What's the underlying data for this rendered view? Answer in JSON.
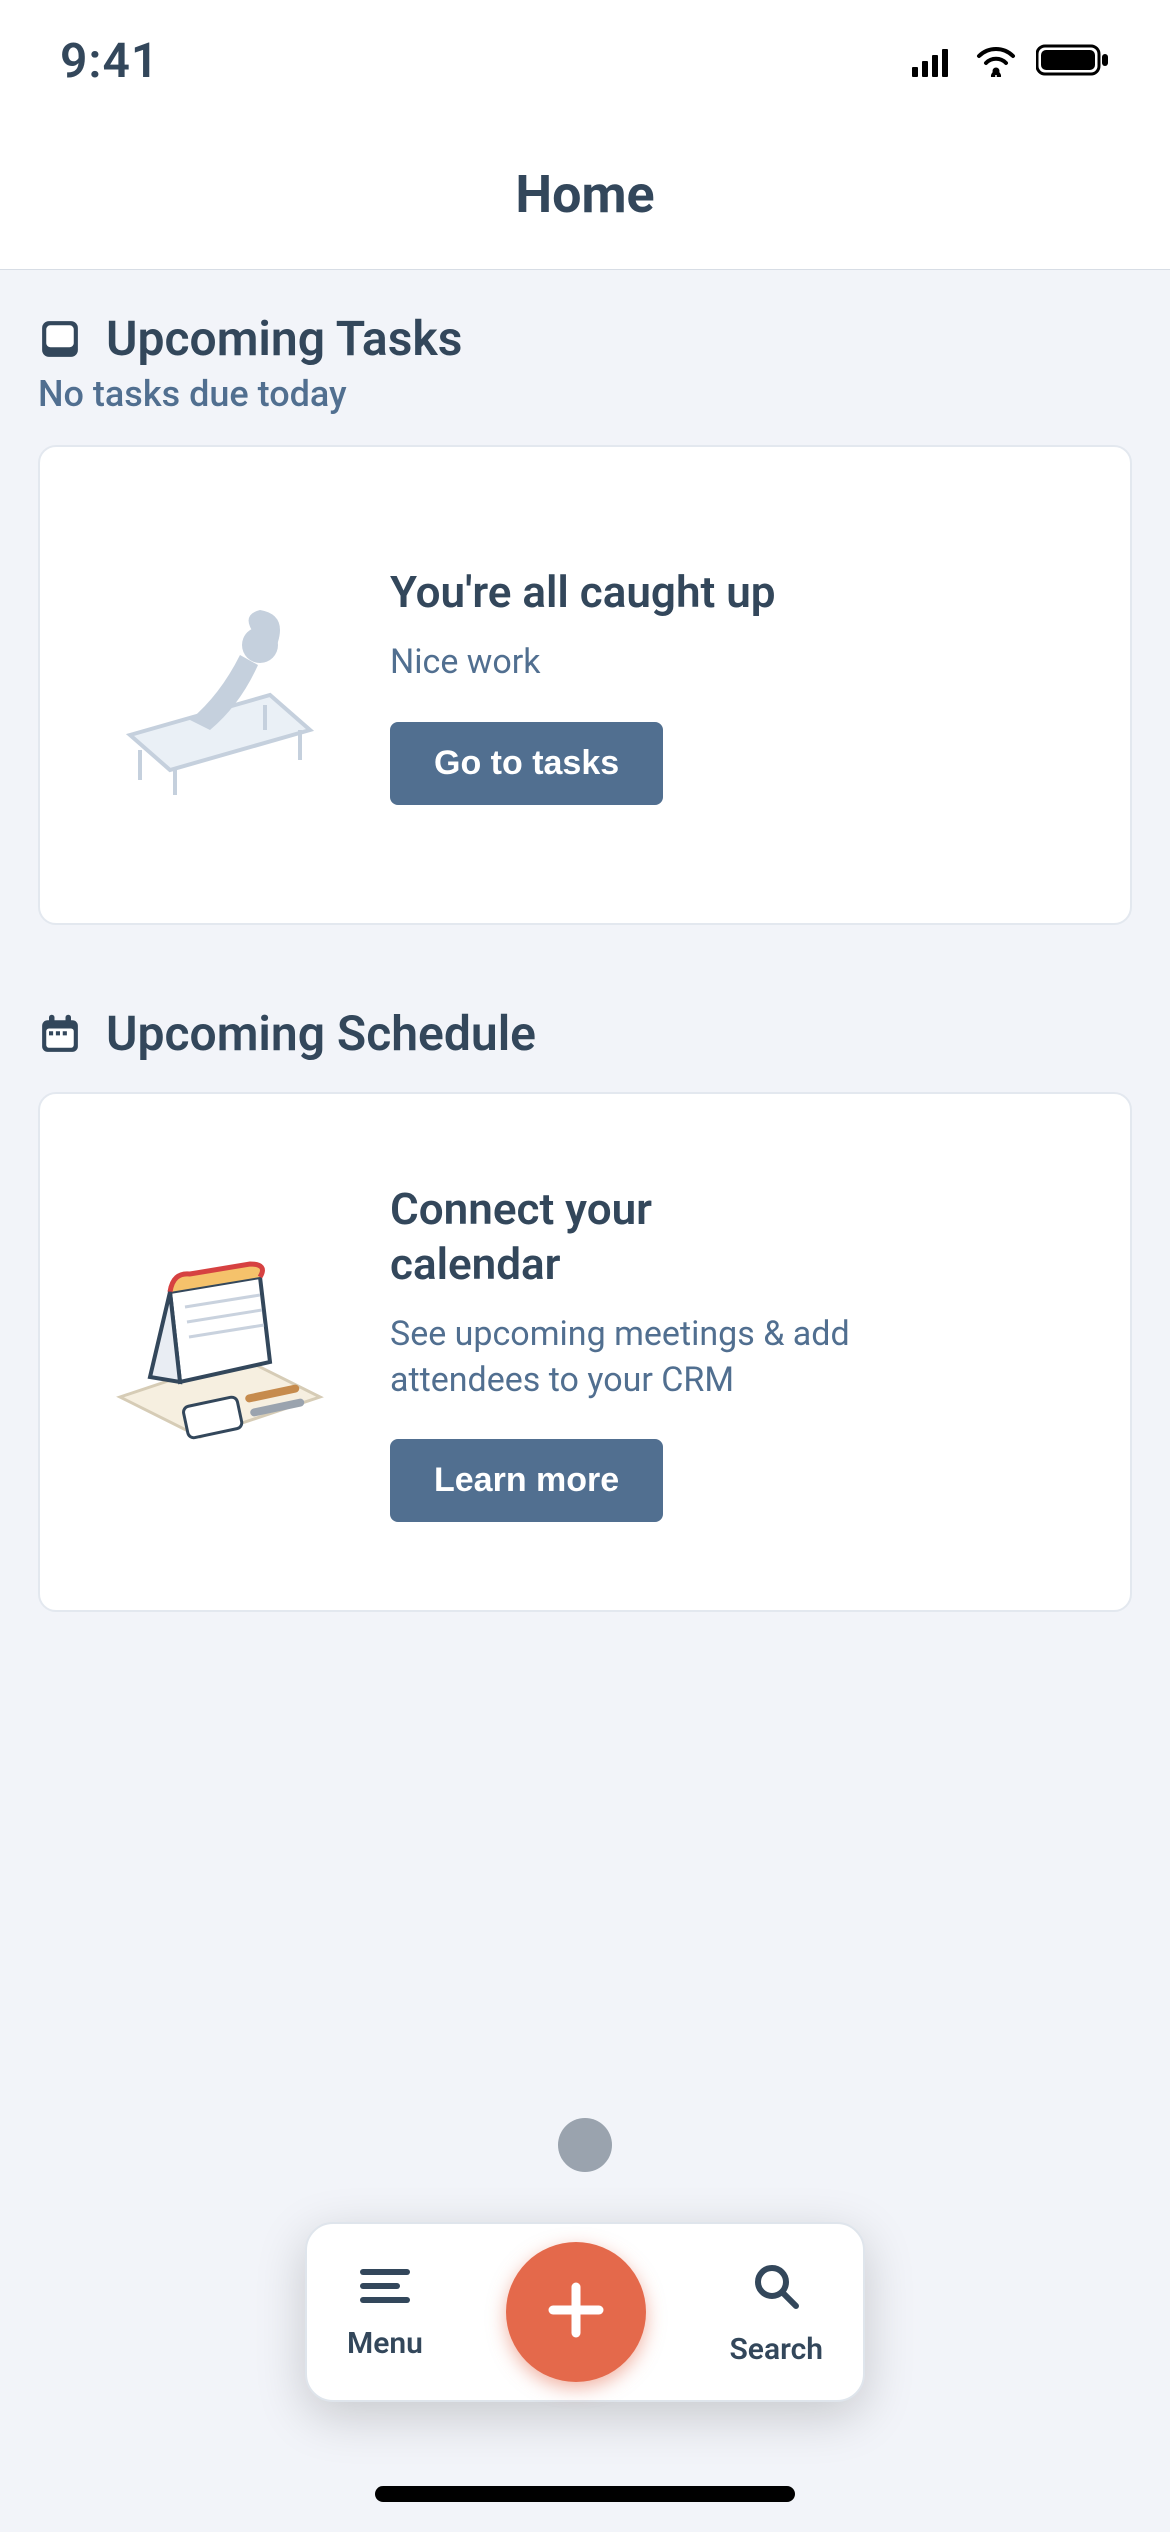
{
  "status": {
    "time": "9:41"
  },
  "header": {
    "title": "Home"
  },
  "tasks": {
    "section_title": "Upcoming Tasks",
    "subtitle": "No tasks due today",
    "card": {
      "title": "You're all caught up",
      "subtitle": "Nice work",
      "button": "Go to tasks"
    }
  },
  "schedule": {
    "section_title": "Upcoming Schedule",
    "card": {
      "title": "Connect your calendar",
      "subtitle": "See upcoming meetings & add attendees to your CRM",
      "button": "Learn more"
    }
  },
  "bottom_bar": {
    "menu": "Menu",
    "search": "Search"
  }
}
